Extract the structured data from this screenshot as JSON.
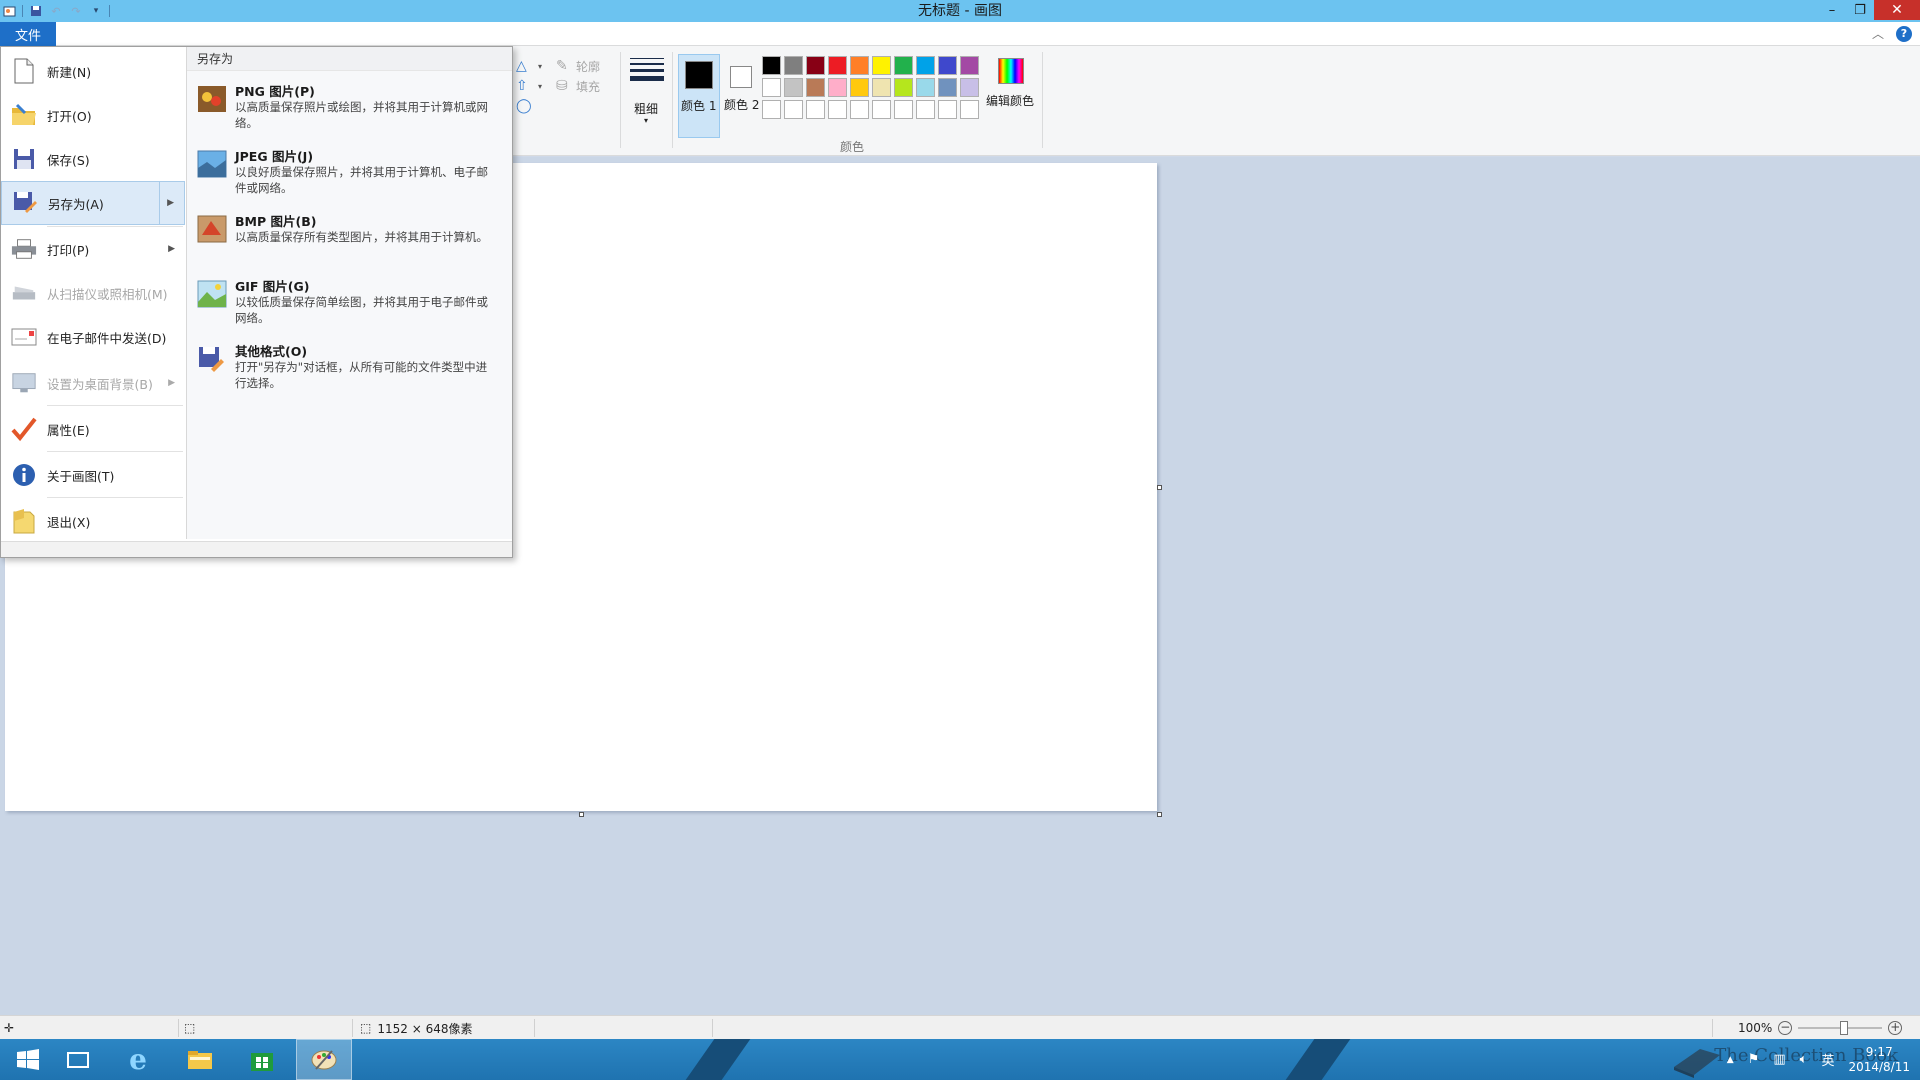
{
  "window": {
    "title": "无标题 - 画图",
    "controls": {
      "minimize": "–",
      "restore": "❐",
      "close": "✕"
    }
  },
  "ribbon": {
    "file_tab": "文件",
    "outline_label": "轮廓",
    "fill_label": "填充",
    "size_label": "粗细",
    "color1_label": "颜色 1",
    "color2_label": "颜色 2",
    "edit_colors_label": "编辑颜色",
    "colors_group_label": "颜色",
    "palette": [
      "#000000",
      "#7f7f7f",
      "#880015",
      "#ed1c24",
      "#ff7f27",
      "#fff200",
      "#22b14c",
      "#00a2e8",
      "#3f48cc",
      "#a349a4",
      "#ffffff",
      "#c3c3c3",
      "#b97a57",
      "#ffaec9",
      "#ffc90e",
      "#efe4b0",
      "#b5e61d",
      "#99d9ea",
      "#7092be",
      "#c8bfe7",
      "#ffffff",
      "#ffffff",
      "#ffffff",
      "#ffffff",
      "#ffffff",
      "#ffffff",
      "#ffffff",
      "#ffffff",
      "#ffffff",
      "#ffffff"
    ]
  },
  "file_menu": {
    "items": [
      {
        "label": "新建(N)",
        "icon": "new-document-icon",
        "enabled": true
      },
      {
        "label": "打开(O)",
        "icon": "open-folder-icon",
        "enabled": true
      },
      {
        "label": "保存(S)",
        "icon": "save-disk-icon",
        "enabled": true
      },
      {
        "label": "另存为(A)",
        "icon": "save-as-icon",
        "enabled": true,
        "submenu": true
      },
      {
        "label": "打印(P)",
        "icon": "printer-icon",
        "enabled": true,
        "submenu": true
      },
      {
        "label": "从扫描仪或照相机(M)",
        "icon": "scanner-icon",
        "enabled": false
      },
      {
        "label": "在电子邮件中发送(D)",
        "icon": "email-icon",
        "enabled": true
      },
      {
        "label": "设置为桌面背景(B)",
        "icon": "desktop-background-icon",
        "enabled": false,
        "submenu": true
      },
      {
        "label": "属性(E)",
        "icon": "checkmark-icon",
        "enabled": true
      },
      {
        "label": "关于画图(T)",
        "icon": "info-icon",
        "enabled": true
      },
      {
        "label": "退出(X)",
        "icon": "exit-icon",
        "enabled": true
      }
    ],
    "submenu_title": "另存为",
    "save_as_options": [
      {
        "title": "PNG 图片(P)",
        "desc": "以高质量保存照片或绘图，并将其用于计算机或网络。",
        "icon": "png-image-icon"
      },
      {
        "title": "JPEG 图片(J)",
        "desc": "以良好质量保存照片，并将其用于计算机、电子邮件或网络。",
        "icon": "jpeg-image-icon"
      },
      {
        "title": "BMP 图片(B)",
        "desc": "以高质量保存所有类型图片，并将其用于计算机。",
        "icon": "bmp-image-icon"
      },
      {
        "title": "GIF 图片(G)",
        "desc": "以较低质量保存简单绘图，并将其用于电子邮件或网络。",
        "icon": "gif-image-icon"
      },
      {
        "title": "其他格式(O)",
        "desc": "打开\"另存为\"对话框，从所有可能的文件类型中进行选择。",
        "icon": "other-formats-icon"
      }
    ]
  },
  "statusbar": {
    "canvas_size": "1152 × 648像素",
    "zoom": "100%"
  },
  "taskbar": {
    "time": "9:17",
    "date": "2014/8/11",
    "ime": "英",
    "watermark": "The Collection Book"
  }
}
